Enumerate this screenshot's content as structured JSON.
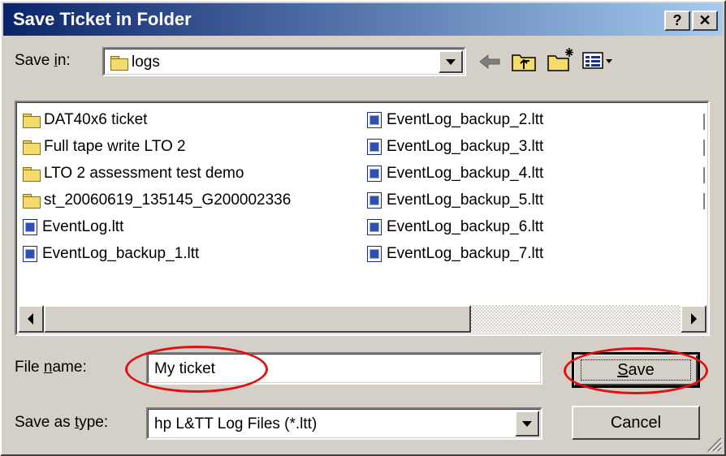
{
  "dialog": {
    "title": "Save Ticket in Folder",
    "help_label": "?",
    "close_label": "✕"
  },
  "save_in": {
    "label_prefix": "Save ",
    "label_underlined": "i",
    "label_suffix": "n:",
    "value": "logs"
  },
  "files": {
    "left_column": [
      {
        "name": "DAT40x6 ticket",
        "kind": "folder"
      },
      {
        "name": "Full tape write LTO 2",
        "kind": "folder"
      },
      {
        "name": "LTO 2 assessment test demo",
        "kind": "folder"
      },
      {
        "name": "st_20060619_135145_G200002336",
        "kind": "folder"
      },
      {
        "name": "EventLog.ltt",
        "kind": "ltt"
      },
      {
        "name": "EventLog_backup_1.ltt",
        "kind": "ltt"
      }
    ],
    "right_column": [
      {
        "name": "EventLog_backup_2.ltt",
        "kind": "ltt"
      },
      {
        "name": "EventLog_backup_3.ltt",
        "kind": "ltt"
      },
      {
        "name": "EventLog_backup_4.ltt",
        "kind": "ltt"
      },
      {
        "name": "EventLog_backup_5.ltt",
        "kind": "ltt"
      },
      {
        "name": "EventLog_backup_6.ltt",
        "kind": "ltt"
      },
      {
        "name": "EventLog_backup_7.ltt",
        "kind": "ltt"
      }
    ]
  },
  "file_name": {
    "label_prefix": "File ",
    "label_underlined": "n",
    "label_suffix": "ame:",
    "value": "My ticket"
  },
  "save_as_type": {
    "label_prefix": "Save as ",
    "label_underlined": "t",
    "label_suffix": "ype:",
    "value": "hp L&TT Log Files (*.ltt)"
  },
  "buttons": {
    "save_underlined": "S",
    "save_rest": "ave",
    "cancel": "Cancel"
  },
  "colors": {
    "title_start": "#0a246a",
    "title_end": "#a6caf0",
    "annotation": "#e01010",
    "face": "#d4d0c8"
  }
}
